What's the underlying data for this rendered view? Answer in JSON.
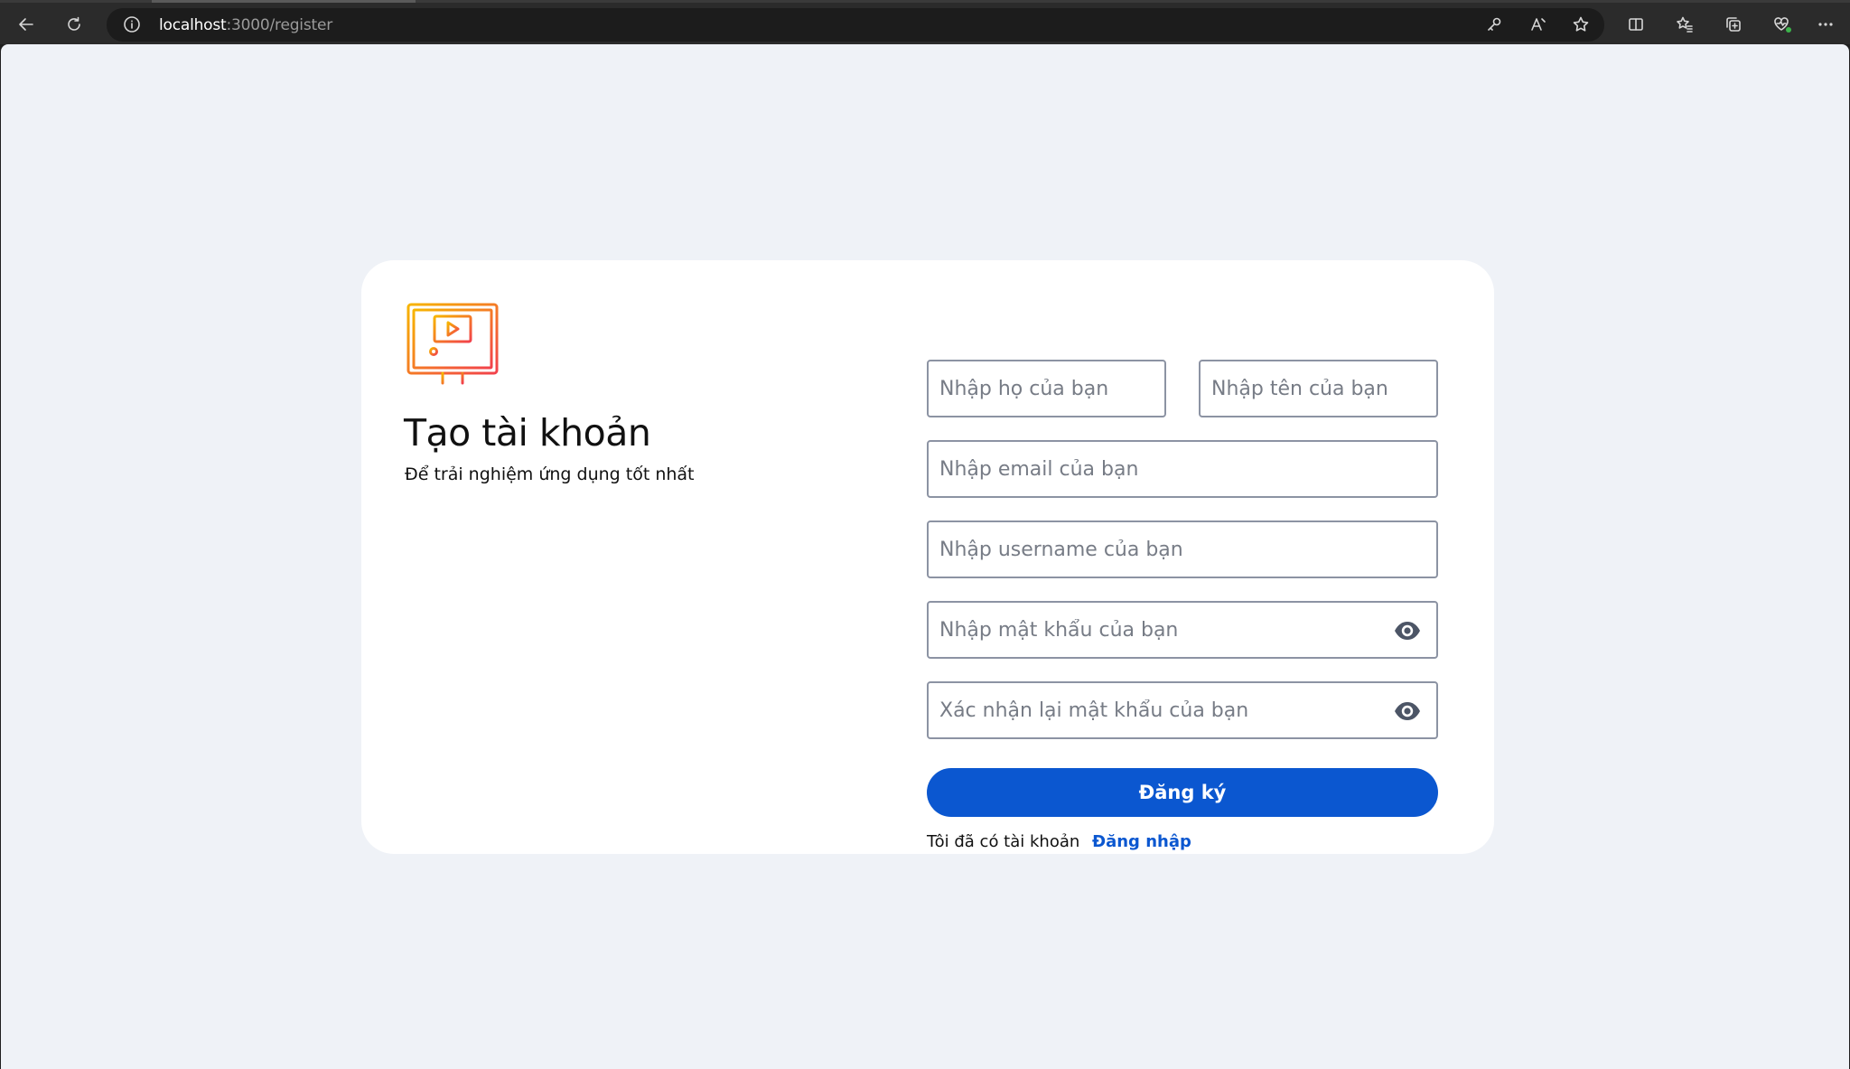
{
  "browser": {
    "url_host": "localhost",
    "url_path": ":3000/register"
  },
  "register": {
    "title": "Tạo tài khoản",
    "subtitle": "Để trải nghiệm ứng dụng tốt nhất",
    "last_name_placeholder": "Nhập họ của bạn",
    "first_name_placeholder": "Nhập tên của bạn",
    "email_placeholder": "Nhập email của bạn",
    "username_placeholder": "Nhập username của bạn",
    "password_placeholder": "Nhập mật khẩu của bạn",
    "confirm_password_placeholder": "Xác nhận lại mật khẩu của bạn",
    "submit_label": "Đăng ký",
    "have_account_text": "Tôi đã có tài khoản",
    "login_link_label": "Đăng nhập"
  },
  "colors": {
    "primary": "#0b57d0",
    "page_background": "#eff2f7",
    "logo_gradient_start": "#f7b500",
    "logo_gradient_end": "#f2414b"
  },
  "icons": [
    "back-arrow-icon",
    "refresh-icon",
    "info-icon",
    "key-icon",
    "read-aloud-icon",
    "favorite-star-icon",
    "split-screen-icon",
    "favorites-icon",
    "collections-icon",
    "browser-health-icon",
    "more-menu-icon",
    "monitor-video-logo-icon",
    "eye-icon"
  ]
}
